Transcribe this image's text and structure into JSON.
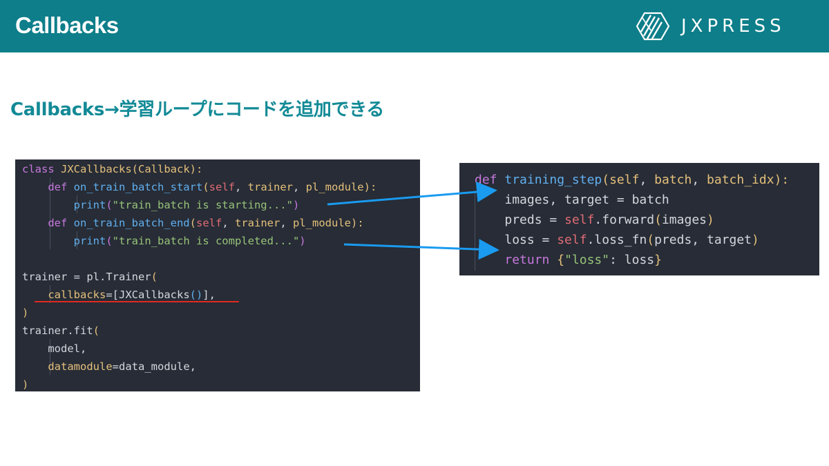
{
  "header": {
    "title": "Callbacks",
    "brand_name": "JXPRESS",
    "colors": {
      "header_bg": "#0d7e8a",
      "accent_teal": "#128a96"
    }
  },
  "slide": {
    "subtitle": "Callbacks→学習ループにコードを追加できる"
  },
  "code_left": {
    "line1": {
      "kw": "class",
      "name": "JXCallbacks",
      "open": "(",
      "base": "Callback",
      "close": "):"
    },
    "line2": {
      "kw": "def",
      "fn": "on_train_batch_start",
      "open": "(",
      "self": "self",
      "sep1": ", ",
      "p1": "trainer",
      "sep2": ", ",
      "p2": "pl_module",
      "close": "):"
    },
    "line3": {
      "fn": "print",
      "open": "(",
      "str": "\"train_batch is starting...\"",
      "close": ")"
    },
    "line4": {
      "kw": "def",
      "fn": "on_train_batch_end",
      "open": "(",
      "self": "self",
      "sep1": ", ",
      "p1": "trainer",
      "sep2": ", ",
      "p2": "pl_module",
      "close": "):"
    },
    "line5": {
      "fn": "print",
      "open": "(",
      "str": "\"train_batch is completed...\"",
      "close": ")"
    },
    "line7": {
      "text": "trainer = pl.Trainer",
      "open": "("
    },
    "line8": {
      "param": "callbacks",
      "eq": "=[",
      "call": "JXCallbacks",
      "parens": "()",
      "close": "],"
    },
    "line9": {
      "close": ")"
    },
    "line10": {
      "text": "trainer.fit",
      "open": "("
    },
    "line11": {
      "text": "model,"
    },
    "line12": {
      "param": "datamodule",
      "eq": "=",
      "value": "data_module,"
    },
    "line13": {
      "close": ")"
    }
  },
  "code_right": {
    "line1": {
      "kw": "def",
      "fn": "training_step",
      "open": "(",
      "self": "self",
      "sep1": ", ",
      "p1": "batch",
      "sep2": ", ",
      "p2": "batch_idx",
      "close": "):"
    },
    "line2": {
      "text": "images, target = batch"
    },
    "line3": {
      "pre": "preds = ",
      "self": "self",
      "dot": ".",
      "attr": "forward",
      "open": "(",
      "arg": "images",
      "close": ")"
    },
    "line4": {
      "pre": "loss = ",
      "self": "self",
      "dot": ".",
      "attr": "loss_fn",
      "open": "(",
      "arg": "preds, target",
      "close": ")"
    },
    "line5": {
      "kw": "return",
      "open": " {",
      "str": "\"loss\"",
      "mid": ": loss",
      "close": "}"
    }
  },
  "colors": {
    "code_bg": "#272c36",
    "arrow": "#1a9bf0",
    "underline": "#e0291f"
  }
}
